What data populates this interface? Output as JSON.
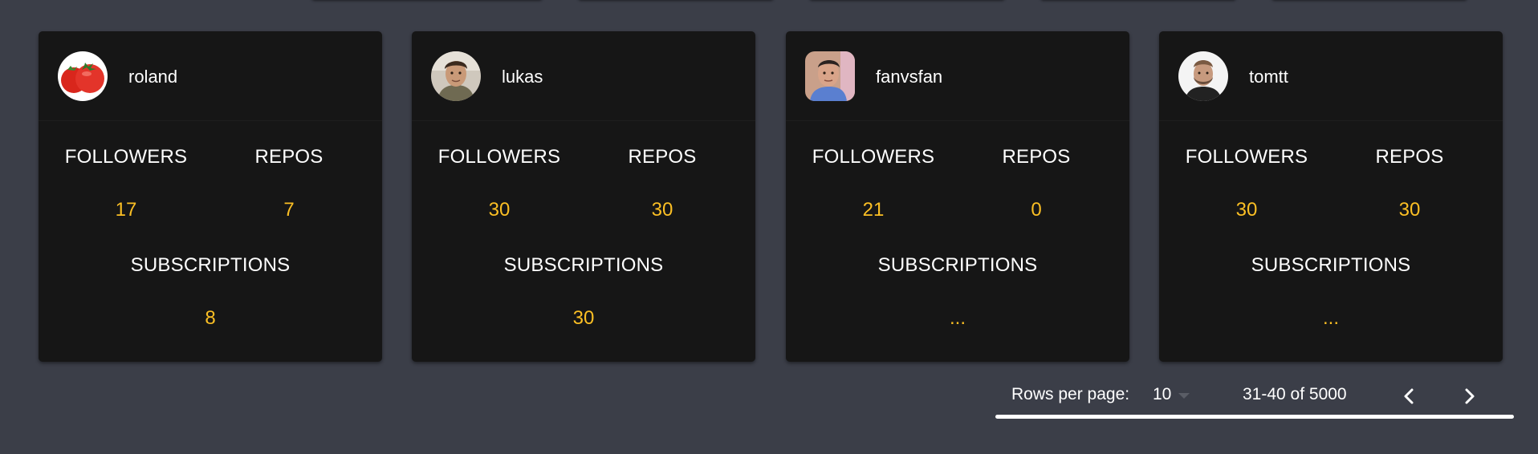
{
  "users": [
    {
      "username": "roland",
      "followers_label": "FOLLOWERS",
      "followers": "17",
      "repos_label": "REPOS",
      "repos": "7",
      "subscriptions_label": "SUBSCRIPTIONS",
      "subscriptions": "8",
      "avatar_icon": "tomato-avatar"
    },
    {
      "username": "lukas",
      "followers_label": "FOLLOWERS",
      "followers": "30",
      "repos_label": "REPOS",
      "repos": "30",
      "subscriptions_label": "SUBSCRIPTIONS",
      "subscriptions": "30",
      "avatar_icon": "person-avatar"
    },
    {
      "username": "fanvsfan",
      "followers_label": "FOLLOWERS",
      "followers": "21",
      "repos_label": "REPOS",
      "repos": "0",
      "subscriptions_label": "SUBSCRIPTIONS",
      "subscriptions": "...",
      "avatar_icon": "person-avatar"
    },
    {
      "username": "tomtt",
      "followers_label": "FOLLOWERS",
      "followers": "30",
      "repos_label": "REPOS",
      "repos": "30",
      "subscriptions_label": "SUBSCRIPTIONS",
      "subscriptions": "...",
      "avatar_icon": "person-avatar"
    }
  ],
  "pagination": {
    "rows_per_page_label": "Rows per page:",
    "rows_per_page_value": "10",
    "range_text": "31-40 of 5000",
    "prev_icon": "chevron-left-icon",
    "next_icon": "chevron-right-icon"
  },
  "colors": {
    "background": "#3b3e48",
    "card": "#161616",
    "accent_value": "#fbbf24"
  }
}
